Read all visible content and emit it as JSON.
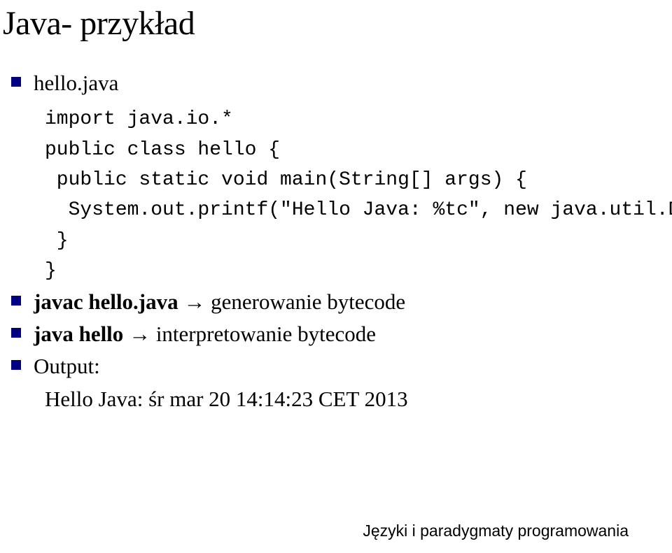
{
  "title": "Java- przykład",
  "items": {
    "item1": "hello.java",
    "code": {
      "l1": "import java.io.*",
      "l2": "public class hello {",
      "l3": " public static void main(String[] args) {",
      "l4": "  System.out.printf(\"Hello Java: %tc\", new java.util.Date());",
      "l5": " }",
      "l6": "}"
    },
    "item2_bold": "javac hello.java",
    "item2_rest": " → generowanie bytecode",
    "item3_bold": "java hello",
    "item3_rest": " → interpretowanie bytecode",
    "item4": "Output:",
    "output_line": "Hello Java: śr mar 20 14:14:23 CET 2013"
  },
  "footer": "Języki i paradygmaty programowania"
}
